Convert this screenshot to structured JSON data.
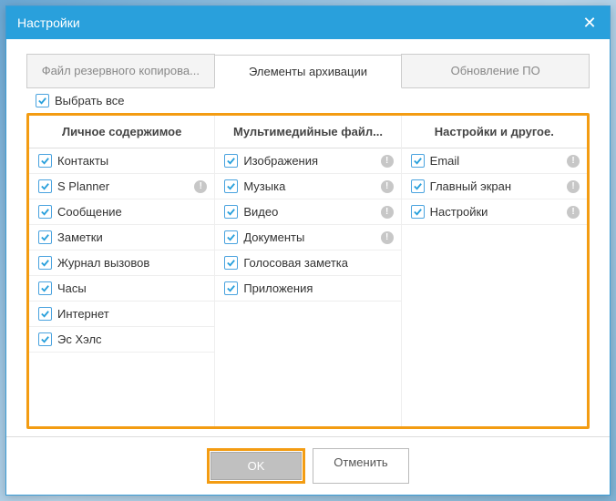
{
  "window": {
    "title": "Настройки"
  },
  "tabs": {
    "t0": "Файл резервного копирова...",
    "t1": "Элементы архивации",
    "t2": "Обновление ПО"
  },
  "selectAll": {
    "label": "Выбрать все"
  },
  "columns": {
    "c0": {
      "header": "Личное содержимое"
    },
    "c1": {
      "header": "Мультимедийные файл..."
    },
    "c2": {
      "header": "Настройки и другое."
    }
  },
  "items": {
    "c0": {
      "i0": "Контакты",
      "i1": "S Planner",
      "i2": "Сообщение",
      "i3": "Заметки",
      "i4": "Журнал вызовов",
      "i5": "Часы",
      "i6": "Интернет",
      "i7": "Эс Хэлс"
    },
    "c1": {
      "i0": "Изображения",
      "i1": "Музыка",
      "i2": "Видео",
      "i3": "Документы",
      "i4": "Голосовая заметка",
      "i5": "Приложения"
    },
    "c2": {
      "i0": "Email",
      "i1": "Главный экран",
      "i2": "Настройки"
    }
  },
  "buttons": {
    "ok": "OK",
    "cancel": "Отменить"
  }
}
